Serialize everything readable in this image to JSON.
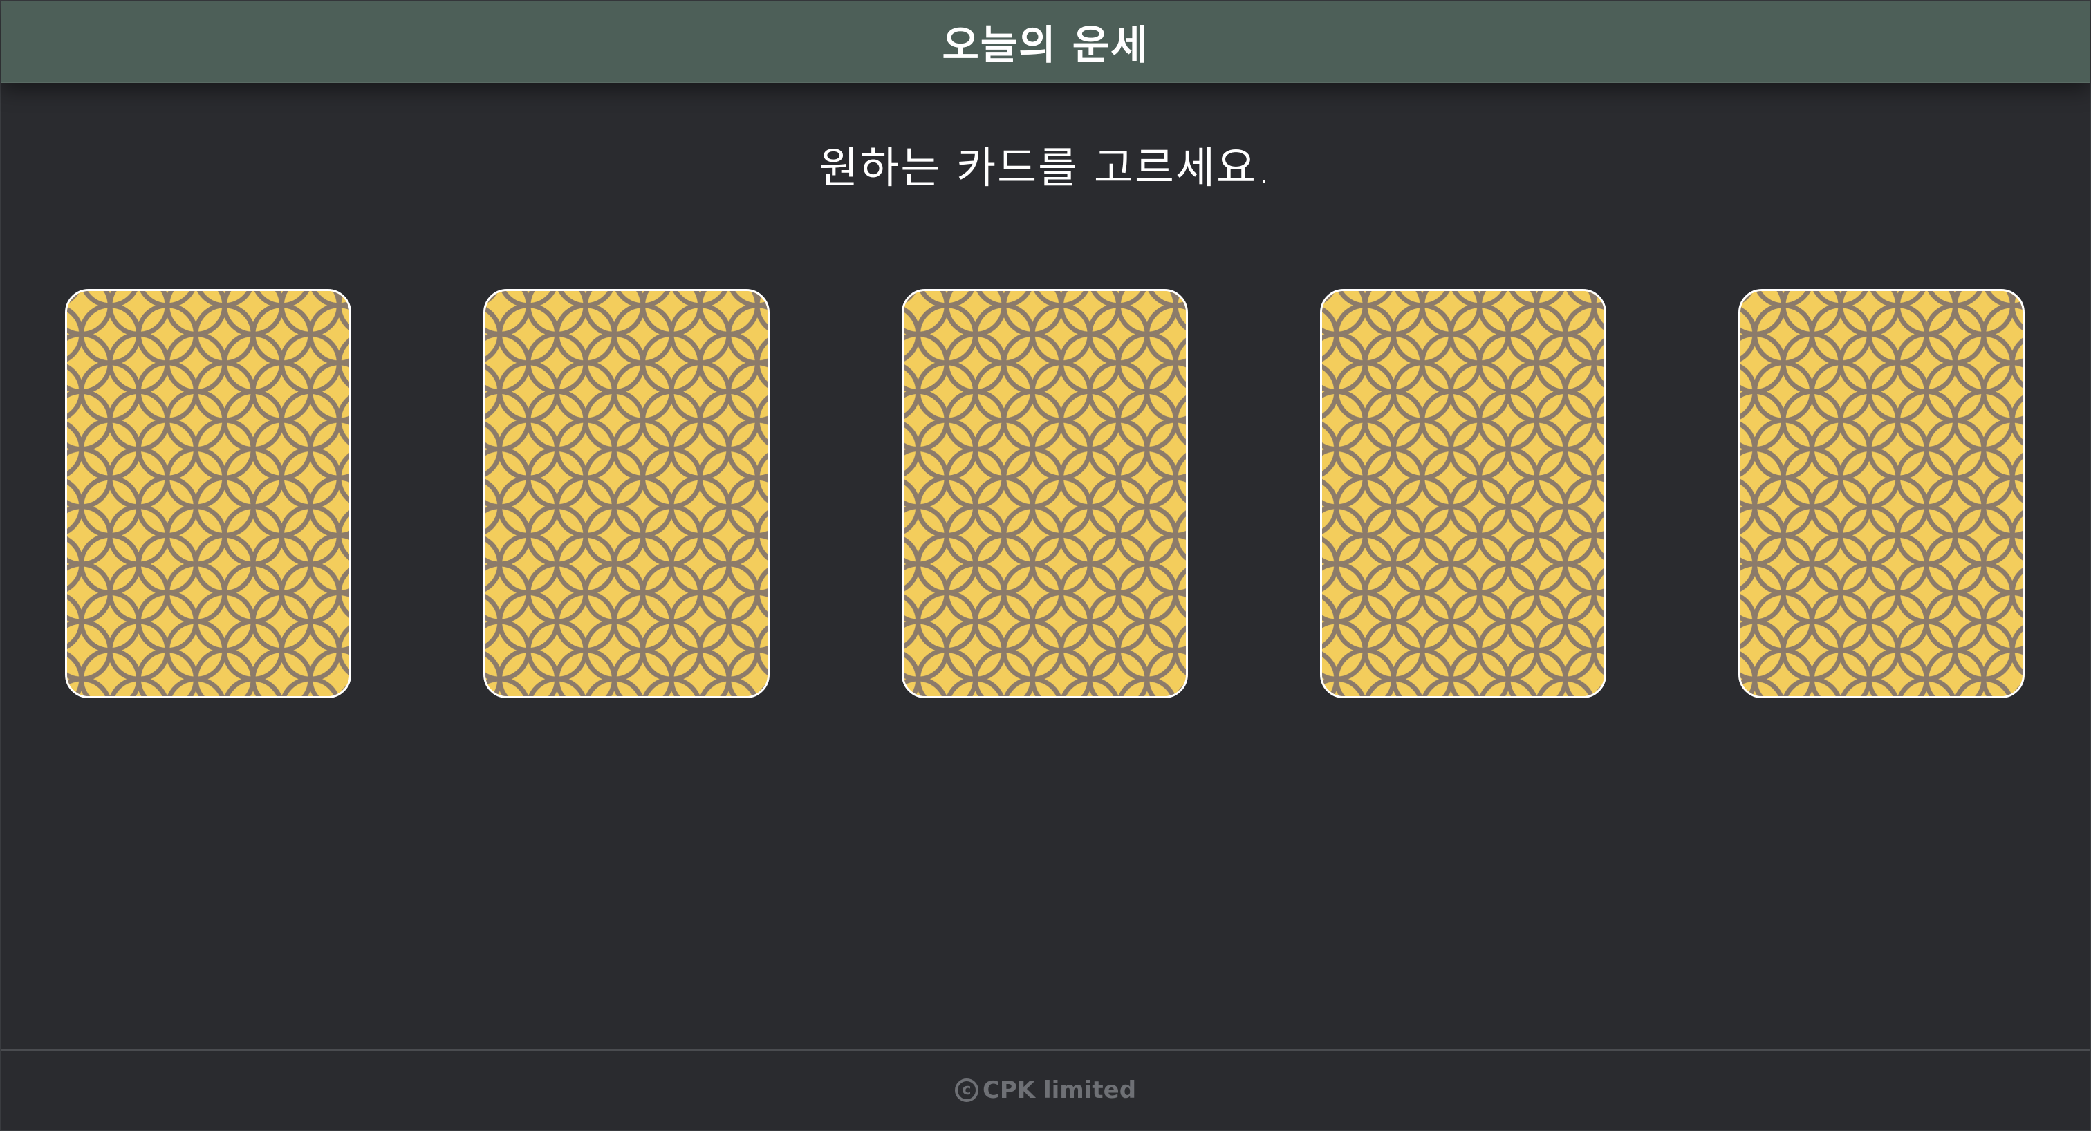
{
  "header": {
    "title": "오늘의 운세"
  },
  "main": {
    "instruction": "원하는 카드를 고르세요.",
    "cards": [
      {
        "face": "back"
      },
      {
        "face": "back"
      },
      {
        "face": "back"
      },
      {
        "face": "back"
      },
      {
        "face": "back"
      }
    ],
    "card_back_icon": "geometric-pattern-icon"
  },
  "footer": {
    "copyright_symbol": "c",
    "copyright_icon": "copyright-icon",
    "text": "CPK limited"
  },
  "colors": {
    "background": "#2a2b2f",
    "header": "#4d5f58",
    "card_pattern_fill": "#f3cd5c",
    "card_pattern_line": "#8c7b6a",
    "card_border": "#ffffff",
    "footer_text": "#6e7075"
  }
}
